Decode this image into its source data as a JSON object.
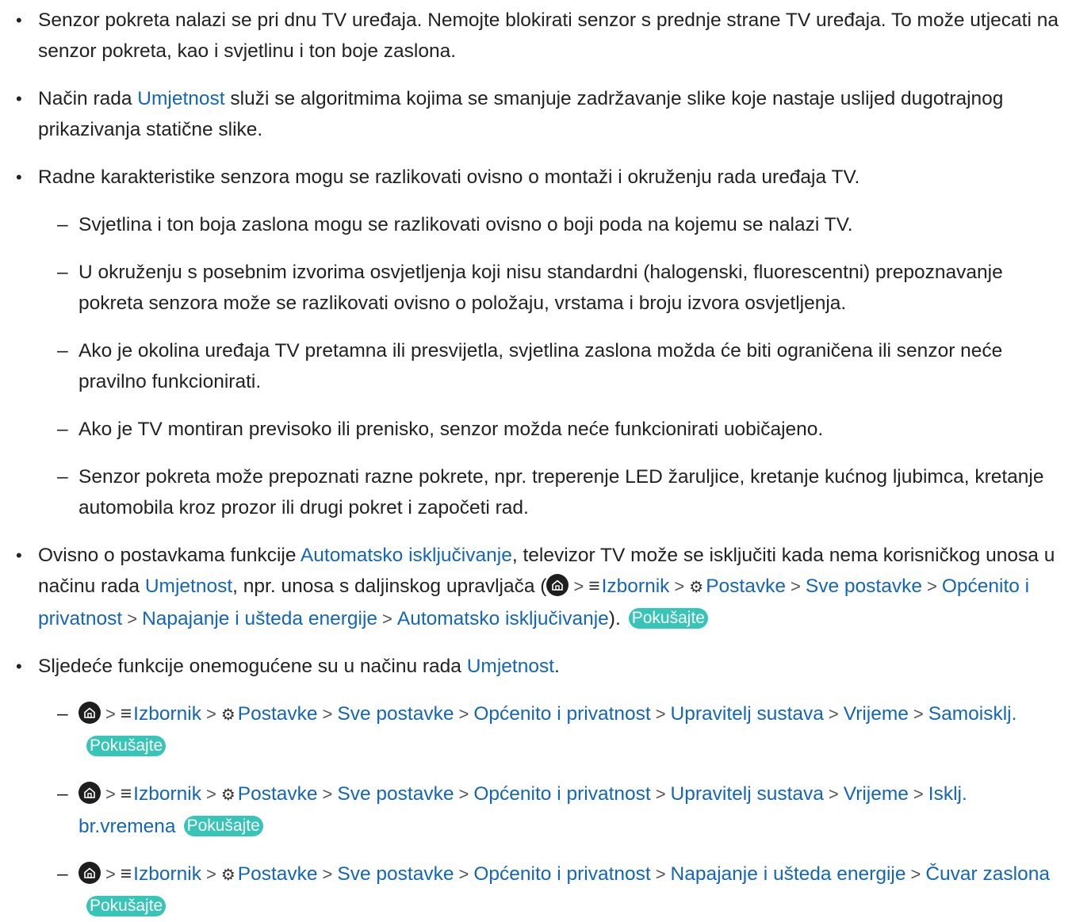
{
  "bullet_char": "•",
  "dash_char": "–",
  "chevron": ">",
  "menu_glyph": "≡",
  "gear_glyph": "⚙",
  "colors": {
    "link": "#1366b8",
    "try_badge": "#36c5b7",
    "home_icon": "#1e1e1e"
  },
  "try_label": "Pokušajte",
  "b1": "Senzor pokreta nalazi se pri dnu TV uređaja. Nemojte blokirati senzor s prednje strane TV uređaja. To može utjecati na senzor pokreta, kao i svjetlinu i ton boje zaslona.",
  "b2": {
    "pre": "Način rada ",
    "link": "Umjetnost",
    "post": " služi se algoritmima kojima se smanjuje zadržavanje slike koje nastaje uslijed dugotrajnog prikazivanja statične slike."
  },
  "b3": "Radne karakteristike senzora mogu se razlikovati ovisno o montaži i okruženju rada uređaja TV.",
  "b3_subs": [
    "Svjetlina i ton boja zaslona mogu se razlikovati ovisno o boji poda na kojemu se nalazi TV.",
    "U okruženju s posebnim izvorima osvjetljenja koji nisu standardni (halogenski, fluorescentni) prepoznavanje pokreta senzora može se razlikovati ovisno o položaju, vrstama i broju izvora osvjetljenja.",
    "Ako je okolina uređaja TV pretamna ili presvijetla, svjetlina zaslona možda će biti ograničena ili senzor neće pravilno funkcionirati.",
    "Ako je TV montiran previsoko ili prenisko, senzor možda neće funkcionirati uobičajeno.",
    "Senzor pokreta može prepoznati razne pokrete, npr. treperenje LED žaruljice, kretanje kućnog ljubimca, kretanje automobila kroz prozor ili drugi pokret i započeti rad."
  ],
  "b4": {
    "t1": "Ovisno o postavkama funkcije ",
    "l1": "Automatsko isključivanje",
    "t2": ", televizor TV može se isključiti kada nema korisničkog unosa u načinu rada ",
    "l2": "Umjetnost",
    "t3": ", npr. unosa s daljinskog upravljača (",
    "path": [
      "Izbornik",
      "Postavke",
      "Sve postavke",
      "Općenito i privatnost",
      "Napajanje i ušteda energije",
      "Automatsko isključivanje"
    ],
    "t4": ")."
  },
  "b5": {
    "pre": "Sljedeće funkcije onemogućene su u načinu rada ",
    "link": "Umjetnost",
    "post": "."
  },
  "b5_paths": [
    [
      "Izbornik",
      "Postavke",
      "Sve postavke",
      "Općenito i privatnost",
      "Upravitelj sustava",
      "Vrijeme",
      "Samoisklj."
    ],
    [
      "Izbornik",
      "Postavke",
      "Sve postavke",
      "Općenito i privatnost",
      "Upravitelj sustava",
      "Vrijeme",
      "Isklj. br.vremena"
    ],
    [
      "Izbornik",
      "Postavke",
      "Sve postavke",
      "Općenito i privatnost",
      "Napajanje i ušteda energije",
      "Čuvar zaslona"
    ]
  ]
}
